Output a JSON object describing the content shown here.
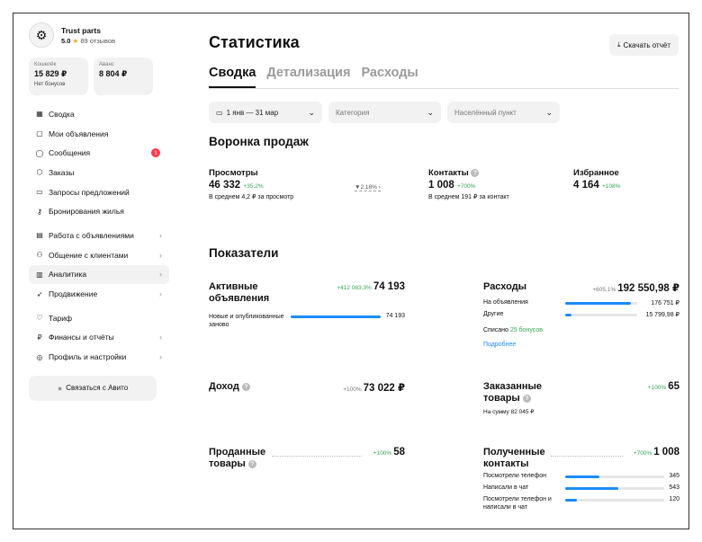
{
  "profile": {
    "name": "Trust parts",
    "rating": "5.0",
    "reviews": "89 отзывов"
  },
  "wallets": [
    {
      "label": "Кошелёк",
      "amount": "15 829 ₽",
      "sub": "Нет бонусов"
    },
    {
      "label": "Аванс",
      "amount": "8 804 ₽",
      "sub": ""
    }
  ],
  "menu": [
    {
      "label": "Сводка",
      "icon": "grid-icon",
      "glyph": "▦"
    },
    {
      "label": "Мои объявления",
      "icon": "listing-icon",
      "glyph": "▢"
    },
    {
      "label": "Сообщения",
      "icon": "chat-icon",
      "glyph": "◯",
      "badge": "1"
    },
    {
      "label": "Заказы",
      "icon": "box-icon",
      "glyph": "⬡"
    },
    {
      "label": "Запросы предложений",
      "icon": "folder-icon",
      "glyph": "▭"
    },
    {
      "label": "Бронирования жилья",
      "icon": "key-icon",
      "glyph": "⚷"
    },
    {
      "label": "Работа с объявлениями",
      "icon": "document-icon",
      "glyph": "▤"
    },
    {
      "label": "Общение с клиентами",
      "icon": "people-icon",
      "glyph": "⚇"
    },
    {
      "label": "Аналитика",
      "icon": "analytics-icon",
      "glyph": "▥"
    },
    {
      "label": "Продвижение",
      "icon": "rocket-icon",
      "glyph": "➶"
    },
    {
      "label": "Тариф",
      "icon": "tariff-icon",
      "glyph": "♡"
    },
    {
      "label": "Финансы и отчёты",
      "icon": "ruble-icon",
      "glyph": "₽"
    },
    {
      "label": "Профиль и настройки",
      "icon": "settings-icon",
      "glyph": "◎"
    }
  ],
  "contact_button": "Связаться с Авито",
  "page": {
    "title": "Статистика",
    "download": "Скачать отчёт"
  },
  "tabs": [
    "Сводка",
    "Детализация",
    "Расходы"
  ],
  "filters": {
    "date": "1 янв — 31 мар",
    "category": "Категория",
    "city": "Населённый пункт"
  },
  "funnel": {
    "title": "Воронка продаж",
    "views": {
      "label": "Просмотры",
      "value": "46 332",
      "delta": "+35,2%",
      "note": "В среднем 4,2 ₽ за просмотр"
    },
    "conversion": "2,18%",
    "contacts": {
      "label": "Контакты",
      "value": "1 008",
      "delta": "+700%",
      "note": "В среднем 191 ₽ за контакт"
    },
    "favorites": {
      "label": "Избранное",
      "value": "4 164",
      "delta": "+108%"
    }
  },
  "indicators": {
    "title": "Показатели",
    "active": {
      "name_line1": "Активные",
      "name_line2": "объявления",
      "delta": "+412 083,3%",
      "value": "74 193",
      "row_label": "Новые и опубликованные заново",
      "row_value": "74 193",
      "row_fraction": 1.0
    },
    "expenses": {
      "name": "Расходы",
      "delta": "+605,1%",
      "value": "192 550,98 ₽",
      "rows": [
        {
          "label": "На объявления",
          "value": "176 751 ₽",
          "fraction": 0.918
        },
        {
          "label": "Другие",
          "value": "15 799,98 ₽",
          "fraction": 0.082
        }
      ],
      "written_off_prefix": "Списано",
      "written_off": "25 бонусов",
      "more": "Подробнее"
    },
    "income": {
      "name": "Доход",
      "delta": "+100%",
      "value": "73 022 ₽"
    },
    "ordered": {
      "name_line1": "Заказанные",
      "name_line2": "товары",
      "delta": "+100%",
      "value": "65",
      "note": "На сумму 82 045 ₽"
    },
    "sold": {
      "name_line1": "Проданные",
      "name_line2": "товары",
      "delta": "+100%",
      "value": "58"
    },
    "received": {
      "name_line1": "Полученные",
      "name_line2": "контакты",
      "delta": "+700%",
      "value": "1 008",
      "rows": [
        {
          "label": "Посмотрели телефон",
          "value": "345",
          "fraction": 0.342
        },
        {
          "label": "Написали в чат",
          "value": "543",
          "fraction": 0.539
        },
        {
          "label": "Посмотрели телефон и написали в чат",
          "value": "120",
          "fraction": 0.119
        }
      ]
    }
  }
}
